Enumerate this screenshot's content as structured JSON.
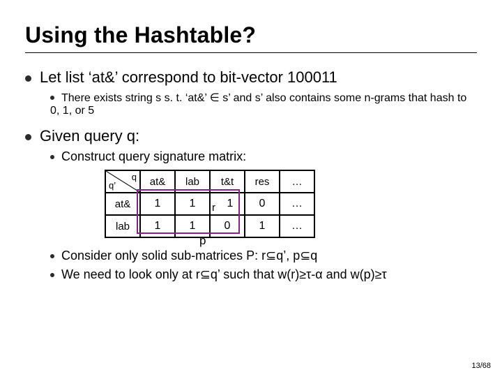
{
  "title": "Using the Hashtable?",
  "items": {
    "let_list": "Let list ‘at&’ correspond to bit-vector 100011",
    "there_exists": "There exists string s s. t. ‘at&’ ∈ s’ and s’ also contains some n-grams that hash to 0, 1, or 5",
    "given_query": "Given query q:",
    "construct": "Construct query signature matrix:",
    "consider": "Consider only solid sub-matrices P: r⊆q’, p⊆q",
    "need": "We need to look only at r⊆q’ such that w(r)≥τ-α and w(p)≥τ"
  },
  "matrix": {
    "diag_qprime": "q’",
    "diag_q": "q",
    "headers": [
      "at&",
      "lab",
      "t&t",
      "res",
      "…"
    ],
    "row_labels": [
      "at&",
      "lab"
    ],
    "data": [
      [
        "1",
        "1",
        "1",
        "0",
        "…"
      ],
      [
        "1",
        "1",
        "0",
        "1",
        "…"
      ]
    ],
    "p_label": "p",
    "r_label": "r"
  },
  "page": "13/68",
  "chart_data": {
    "type": "table",
    "title": "query signature matrix",
    "row_index_label": "q'",
    "col_index_label": "q",
    "col_headers": [
      "at&",
      "lab",
      "t&t",
      "res",
      "…"
    ],
    "row_headers": [
      "at&",
      "lab"
    ],
    "values": [
      [
        1,
        1,
        1,
        0,
        null
      ],
      [
        1,
        1,
        0,
        1,
        null
      ]
    ],
    "highlighted_submatrix": {
      "rows": [
        "at&",
        "lab"
      ],
      "cols": [
        "at&",
        "lab",
        "t&t"
      ],
      "label": "P"
    }
  }
}
